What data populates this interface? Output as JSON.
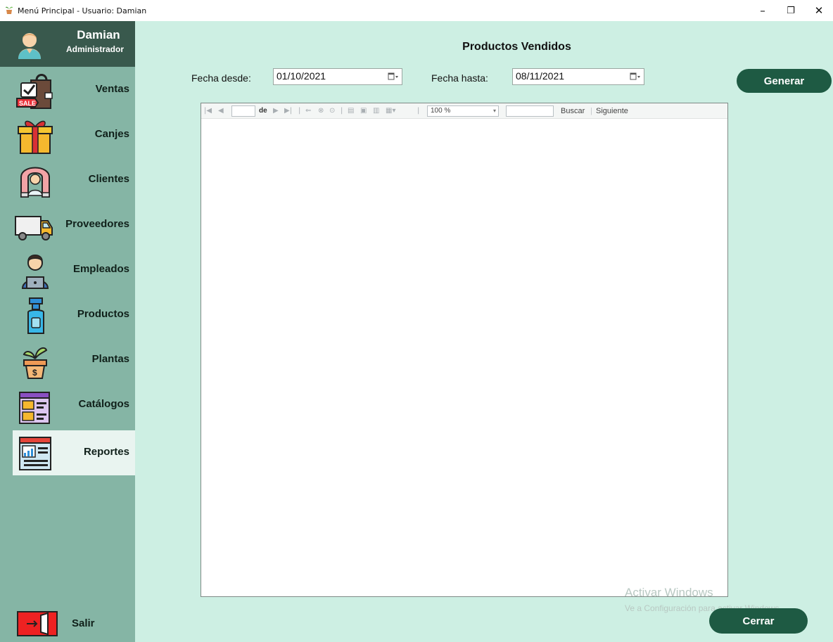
{
  "window": {
    "title": "Menú Principal - Usuario: Damian",
    "minimize": "–",
    "maximize": "❐",
    "close": "✕"
  },
  "user": {
    "name": "Damian",
    "role": "Administrador",
    "icon": "user-avatar-icon"
  },
  "sidebar": {
    "items": [
      {
        "label": "Ventas",
        "icon": "sale-bag-icon"
      },
      {
        "label": "Canjes",
        "icon": "gift-icon"
      },
      {
        "label": "Clientes",
        "icon": "customer-magnet-icon"
      },
      {
        "label": "Proveedores",
        "icon": "truck-icon"
      },
      {
        "label": "Empleados",
        "icon": "employee-laptop-icon"
      },
      {
        "label": "Productos",
        "icon": "spray-bottle-icon"
      },
      {
        "label": "Plantas",
        "icon": "plant-pot-icon"
      },
      {
        "label": "Catálogos",
        "icon": "catalog-icon"
      },
      {
        "label": "Reportes",
        "icon": "report-chart-icon",
        "active": true
      }
    ],
    "exit": {
      "label": "Salir",
      "icon": "exit-door-icon"
    }
  },
  "main": {
    "title": "Productos Vendidos",
    "from_label": "Fecha desde:",
    "from_value": "01/10/2021",
    "to_label": "Fecha hasta:",
    "to_value": "08/11/2021",
    "generate_label": "Generar",
    "close_label": "Cerrar"
  },
  "viewer": {
    "of_label": "de",
    "zoom": "100 %",
    "find_label": "Buscar",
    "separator": "|",
    "next_label": "Siguiente"
  },
  "watermark": {
    "line1": "Activar Windows",
    "line2": "Ve a Configuración para activar Windows."
  },
  "colors": {
    "sidebar": "#85b5a5",
    "user_panel": "#39594d",
    "main_bg": "#cdefe3",
    "button": "#1e5a43",
    "active_item": "#e9f4f0"
  }
}
